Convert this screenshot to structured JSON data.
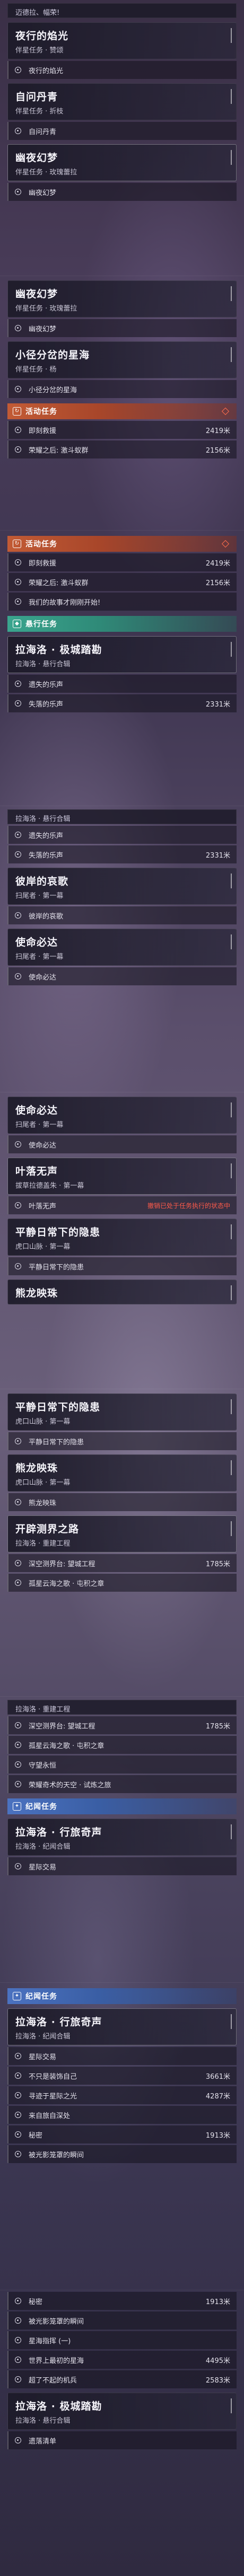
{
  "screens": [
    {
      "top_hint": "迈德拉、幅荣!",
      "blocks": [
        {
          "kind": "quest",
          "title": "夜行的焰光",
          "sub": "伴星任务 · 赞颂",
          "active": false
        },
        {
          "kind": "sub",
          "label": "夜行的焰光"
        },
        {
          "kind": "quest",
          "title": "自问丹青",
          "sub": "伴星任务 · 折枝",
          "active": false
        },
        {
          "kind": "sub",
          "label": "自问丹青"
        },
        {
          "kind": "quest",
          "title": "幽夜幻梦",
          "sub": "伴星任务 · 玫瑰蕾拉",
          "active": true
        },
        {
          "kind": "sub",
          "label": "幽夜幻梦"
        }
      ]
    },
    {
      "blocks": [
        {
          "kind": "quest",
          "title": "幽夜幻梦",
          "sub": "伴星任务 · 玫瑰蕾拉",
          "active": false
        },
        {
          "kind": "sub",
          "label": "幽夜幻梦"
        },
        {
          "kind": "quest",
          "title": "小径分岔的星海",
          "sub": "伴星任务 · 杨",
          "active": false
        },
        {
          "kind": "sub",
          "label": "小径分岔的星海"
        },
        {
          "kind": "cat",
          "title": "活动任务",
          "color": "orange",
          "icon": "↻",
          "diamond": true
        },
        {
          "kind": "sub",
          "label": "即刻救援",
          "dist": "2419米"
        },
        {
          "kind": "sub",
          "label": "荣耀之后: 激斗蚁群",
          "dist": "2156米"
        }
      ]
    },
    {
      "blocks": [
        {
          "kind": "cat",
          "title": "活动任务",
          "color": "orange",
          "icon": "↻",
          "diamond": true
        },
        {
          "kind": "sub",
          "label": "即刻救援",
          "dist": "2419米"
        },
        {
          "kind": "sub",
          "label": "荣耀之后: 激斗蚁群",
          "dist": "2156米"
        },
        {
          "kind": "sub",
          "label": "我们的故事才刚刚开始!"
        },
        {
          "kind": "cat",
          "title": "悬行任务",
          "color": "teal",
          "icon": "◆",
          "diamond": false
        },
        {
          "kind": "quest",
          "title": "拉海洛 · 极城踏勘",
          "sub": "拉海洛 · 悬行合辑",
          "active": true
        },
        {
          "kind": "sub",
          "label": "遗失的乐声"
        },
        {
          "kind": "sub",
          "label": "失落的乐声",
          "dist": "2331米"
        }
      ]
    },
    {
      "blocks": [
        {
          "kind": "cut",
          "label": "拉海洛 · 悬行合辑"
        },
        {
          "kind": "sub",
          "label": "遗失的乐声"
        },
        {
          "kind": "sub",
          "label": "失落的乐声",
          "dist": "2331米"
        },
        {
          "kind": "quest",
          "title": "彼岸的哀歌",
          "sub": "扫尾者 · 第一幕",
          "active": false
        },
        {
          "kind": "sub",
          "label": "彼岸的哀歌"
        },
        {
          "kind": "quest",
          "title": "使命必达",
          "sub": "扫尾者 · 第一幕",
          "active": false
        },
        {
          "kind": "sub",
          "label": "使命必达"
        }
      ]
    },
    {
      "blocks": [
        {
          "kind": "quest",
          "title": "使命必达",
          "sub": "扫尾者 · 第一幕",
          "active": false
        },
        {
          "kind": "sub",
          "label": "使命必达"
        },
        {
          "kind": "quest",
          "title": "叶落无声",
          "sub": "拔草拉德盖朱 · 第一幕",
          "active": true
        },
        {
          "kind": "sub",
          "label": "叶落无声",
          "warn": "撤销已处于任务执行的状态中"
        },
        {
          "kind": "quest",
          "title": "平静日常下的隐患",
          "sub": "虎口山脉 · 第一幕",
          "active": false
        },
        {
          "kind": "sub",
          "label": "平静日常下的隐患"
        },
        {
          "kind": "quest",
          "title": "熊龙映珠",
          "sub": "",
          "active": false
        }
      ]
    },
    {
      "blocks": [
        {
          "kind": "quest",
          "title": "平静日常下的隐患",
          "sub": "虎口山脉 · 第一幕",
          "active": false
        },
        {
          "kind": "sub",
          "label": "平静日常下的隐患"
        },
        {
          "kind": "quest",
          "title": "熊龙映珠",
          "sub": "虎口山脉 · 第一幕",
          "active": false
        },
        {
          "kind": "sub",
          "label": "熊龙映珠"
        },
        {
          "kind": "quest",
          "title": "开辟测界之路",
          "sub": "拉海洛 · 重建工程",
          "active": true
        },
        {
          "kind": "sub",
          "label": "深空测界台: 望城工程",
          "dist": "1785米"
        },
        {
          "kind": "sub",
          "label": "孤星云海之歌 · 屯积之章"
        }
      ]
    },
    {
      "blocks": [
        {
          "kind": "cut",
          "label": "拉海洛 · 重建工程"
        },
        {
          "kind": "sub",
          "label": "深空测界台: 望城工程",
          "dist": "1785米"
        },
        {
          "kind": "sub",
          "label": "孤星云海之歌 · 屯积之章"
        },
        {
          "kind": "sub",
          "label": "守望永恒"
        },
        {
          "kind": "sub",
          "label": "荣耀奇术的天空 · 试炼之旅"
        },
        {
          "kind": "cat",
          "title": "纪闻任务",
          "color": "blue",
          "icon": "✦",
          "diamond": false
        },
        {
          "kind": "quest",
          "title": "拉海洛 · 行旅奇声",
          "sub": "拉海洛 · 纪闻合辑",
          "active": false
        },
        {
          "kind": "sub",
          "label": "星际交易"
        }
      ]
    },
    {
      "blocks": [
        {
          "kind": "cat",
          "title": "纪闻任务",
          "color": "blue",
          "icon": "✦",
          "diamond": false
        },
        {
          "kind": "quest",
          "title": "拉海洛 · 行旅奇声",
          "sub": "拉海洛 · 纪闻合辑",
          "active": true
        },
        {
          "kind": "sub",
          "label": "星际交易"
        },
        {
          "kind": "sub",
          "label": "不只是装饰自己",
          "dist": "3661米"
        },
        {
          "kind": "sub",
          "label": "寻迹于星际之光",
          "dist": "4287米"
        },
        {
          "kind": "sub",
          "label": "来自旅自深处"
        },
        {
          "kind": "sub",
          "label": "秘密",
          "dist": "1913米"
        },
        {
          "kind": "sub",
          "label": "被光影笼罩的瞬间"
        }
      ]
    },
    {
      "blocks": [
        {
          "kind": "sub",
          "label": "秘密",
          "dist": "1913米"
        },
        {
          "kind": "sub",
          "label": "被光影笼罩的瞬间"
        },
        {
          "kind": "sub",
          "label": "星海指挥 (一)"
        },
        {
          "kind": "sub",
          "label": "世界上最初的星海",
          "dist": "4495米"
        },
        {
          "kind": "sub",
          "label": "超了不起的机兵",
          "dist": "2583米"
        },
        {
          "kind": "quest",
          "title": "拉海洛 · 极城踏勘",
          "sub": "拉海洛 · 悬行合辑",
          "active": false
        },
        {
          "kind": "sub",
          "label": "遗落清单"
        }
      ]
    }
  ]
}
